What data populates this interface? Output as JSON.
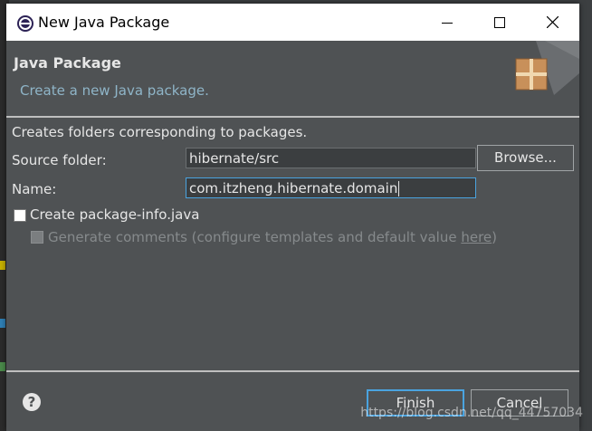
{
  "window": {
    "title": "New Java Package"
  },
  "banner": {
    "title": "Java Package",
    "description": "Create a new Java package."
  },
  "info": "Creates folders corresponding to packages.",
  "form": {
    "source_folder": {
      "label": "Source folder:",
      "value": "hibernate/src"
    },
    "name": {
      "label": "Name:",
      "value": "com.itzheng.hibernate.domain"
    },
    "browse_label": "Browse..."
  },
  "options": {
    "create_package_info": {
      "label": "Create package-info.java",
      "checked": false
    },
    "generate_comments": {
      "label_prefix": "Generate comments (configure templates and default value ",
      "link": "here",
      "label_suffix": ")",
      "checked": false,
      "enabled": false
    }
  },
  "footer": {
    "finish_label": "Finish",
    "cancel_label": "Cancel",
    "help_symbol": "?"
  },
  "watermark": "https://blog.csdn.net/qq_44757034",
  "colors": {
    "accent": "#4aa3df",
    "dialog_bg": "#4f5254",
    "link_desc": "#8fb5c8"
  }
}
